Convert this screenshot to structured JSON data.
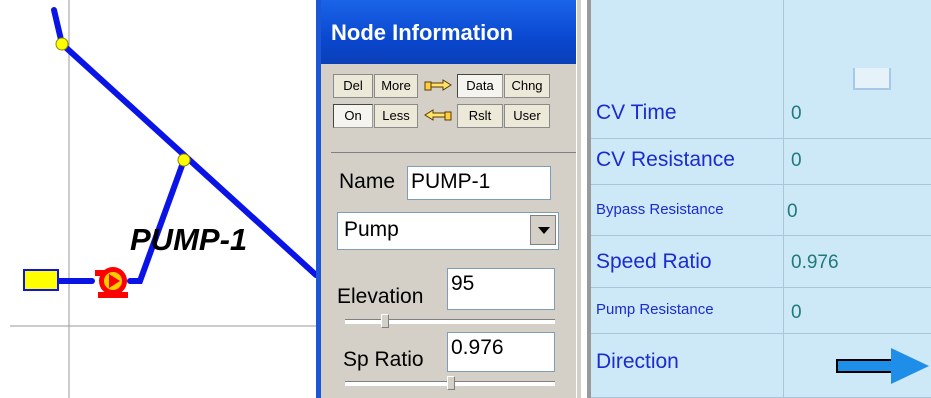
{
  "canvas": {
    "pump_label": "PUMP-1"
  },
  "panel": {
    "title": "Node Information",
    "toolbar": {
      "row1": [
        "Del",
        "More",
        "Data",
        "Chng"
      ],
      "row2": [
        "On",
        "Less",
        "Rslt",
        "User"
      ],
      "icons": [
        "pointing-hand-right-icon",
        "pointing-hand-left-icon"
      ]
    },
    "name_label": "Name",
    "name_value": "PUMP-1",
    "type_value": "Pump",
    "elevation_label": "Elevation",
    "elevation_value": "95",
    "sp_ratio_label": "Sp Ratio",
    "sp_ratio_value": "0.976"
  },
  "grid": {
    "rows": [
      {
        "name": "CV Time",
        "value": "0"
      },
      {
        "name": "CV Resistance",
        "value": "0"
      },
      {
        "name": "Bypass Resistance",
        "value": "0"
      },
      {
        "name": "Speed Ratio",
        "value": "0.976"
      },
      {
        "name": "Pump Resistance",
        "value": "0"
      },
      {
        "name": "Direction",
        "value": ""
      }
    ],
    "direction_icon": "arrow-right-icon"
  },
  "colors": {
    "pipe": "#0a14e6",
    "node": "#ffff00",
    "pump": "#ff0000",
    "title_bar": "#0a48d0",
    "grid_bg": "#cde8f7",
    "grid_name": "#1a2ccf",
    "grid_value": "#1f7a7a",
    "arrow": "#1e8ee8"
  }
}
